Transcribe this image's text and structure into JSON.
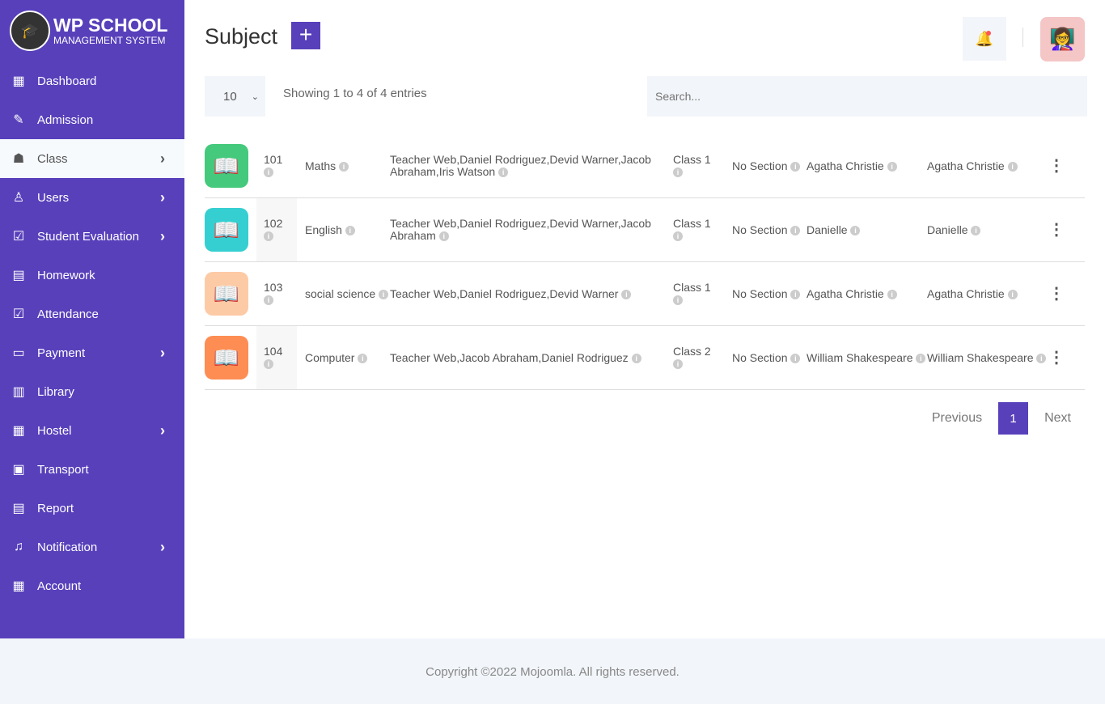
{
  "brand": {
    "line1": "WP SCHOOL",
    "line2": "MANAGEMENT SYSTEM"
  },
  "nav": [
    {
      "label": "Dashboard",
      "icon": "grid-icon",
      "glyph": "▦",
      "chevron": false
    },
    {
      "label": "Admission",
      "icon": "admission-icon",
      "glyph": "✎",
      "chevron": false
    },
    {
      "label": "Class",
      "icon": "class-icon",
      "glyph": "☗",
      "chevron": true,
      "active": true
    },
    {
      "label": "Users",
      "icon": "user-icon",
      "glyph": "♙",
      "chevron": true
    },
    {
      "label": "Student Evaluation",
      "icon": "clipboard-icon",
      "glyph": "☑",
      "chevron": true
    },
    {
      "label": "Homework",
      "icon": "homework-icon",
      "glyph": "▤",
      "chevron": false
    },
    {
      "label": "Attendance",
      "icon": "attendance-icon",
      "glyph": "☑",
      "chevron": false
    },
    {
      "label": "Payment",
      "icon": "wallet-icon",
      "glyph": "▭",
      "chevron": true
    },
    {
      "label": "Library",
      "icon": "library-icon",
      "glyph": "▥",
      "chevron": false
    },
    {
      "label": "Hostel",
      "icon": "hostel-icon",
      "glyph": "▦",
      "chevron": true
    },
    {
      "label": "Transport",
      "icon": "bus-icon",
      "glyph": "▣",
      "chevron": false
    },
    {
      "label": "Report",
      "icon": "report-icon",
      "glyph": "▤",
      "chevron": false
    },
    {
      "label": "Notification",
      "icon": "bell-icon",
      "glyph": "♫",
      "chevron": true
    },
    {
      "label": "Account",
      "icon": "account-icon",
      "glyph": "▦",
      "chevron": false
    }
  ],
  "header": {
    "title": "Subject",
    "add": "+"
  },
  "controls": {
    "length": "10",
    "info": "Showing 1 to 4 of 4 entries",
    "search_placeholder": "Search..."
  },
  "rows": [
    {
      "color": "#45c97c",
      "code": "101",
      "name": "Maths",
      "teachers": "Teacher Web,Daniel Rodriguez,Devid Warner,Jacob Abraham,Iris Watson",
      "class": "Class 1",
      "section": "No Section",
      "t1": "Agatha Christie",
      "t2": "Agatha Christie"
    },
    {
      "color": "#36cfd1",
      "code": "102",
      "name": "English",
      "teachers": "Teacher Web,Daniel Rodriguez,Devid Warner,Jacob Abraham",
      "class": "Class 1",
      "section": "No Section",
      "t1": "Danielle",
      "t2": "Danielle"
    },
    {
      "color": "#fdcaa6",
      "code": "103",
      "name": "social science",
      "teachers": "Teacher Web,Daniel Rodriguez,Devid Warner",
      "class": "Class 1",
      "section": "No Section",
      "t1": "Agatha Christie",
      "t2": "Agatha Christie"
    },
    {
      "color": "#fd8d53",
      "code": "104",
      "name": "Computer",
      "teachers": "Teacher Web,Jacob Abraham,Daniel Rodriguez",
      "class": "Class 2",
      "section": "No Section",
      "t1": "William Shakespeare",
      "t2": "William Shakespeare"
    }
  ],
  "pager": {
    "prev": "Previous",
    "current": "1",
    "next": "Next"
  },
  "footer": "Copyright ©2022 Mojoomla. All rights reserved."
}
